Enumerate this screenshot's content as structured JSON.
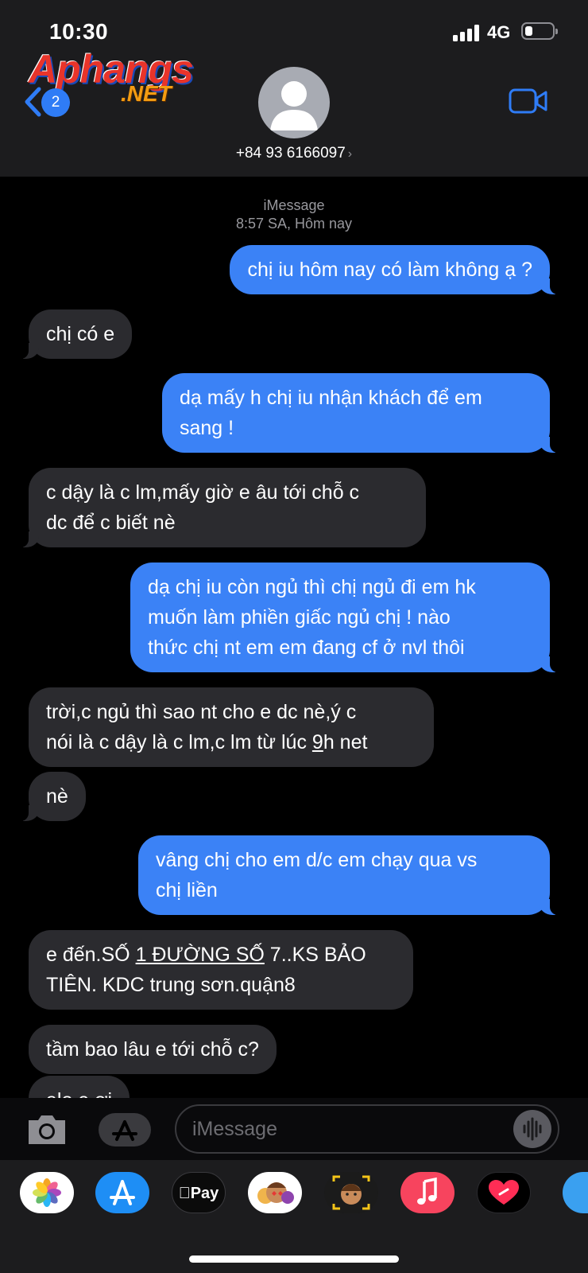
{
  "status": {
    "time": "10:30",
    "network": "4G"
  },
  "watermark": {
    "main": "Aphangs",
    "suffix": ".NET"
  },
  "header": {
    "back_badge": "2",
    "contact": "+84 93 6166097",
    "chevron": "›"
  },
  "thread": {
    "service": "iMessage",
    "timestamp": "8:57 SA, Hôm nay"
  },
  "messages": [
    {
      "side": "out",
      "lines": [
        "chị iu hôm nay có làm không ạ ?"
      ]
    },
    {
      "side": "in",
      "lines": [
        "chị có e"
      ]
    },
    {
      "side": "out",
      "lines": [
        "dạ mấy h chị iu nhận khách để em",
        "sang !"
      ]
    },
    {
      "side": "in",
      "lines": [
        "c dậy là c lm,mấy giờ e âu tới chỗ c",
        "dc để c biết nè"
      ]
    },
    {
      "side": "out",
      "lines": [
        "dạ chị iu còn ngủ thì chị ngủ đi em hk",
        "muốn làm phiền giấc ngủ chị ! nào",
        "thức chị nt em em đang cf ở nvl thôi"
      ]
    },
    {
      "side": "in",
      "lines": [
        "trời,c ngủ thì sao nt cho e dc nè,ý c",
        "nói là c dậy là c lm,c lm từ lúc"
      ],
      "line2_link": "9",
      "line2_rest": "h net"
    },
    {
      "side": "in",
      "lines": [
        "nè"
      ]
    },
    {
      "side": "out",
      "lines": [
        "vâng chị cho em d/c em chạy qua vs",
        "chị liền"
      ]
    },
    {
      "side": "in",
      "line1_a": "e đến.SỐ ",
      "line1_link": "1 ĐƯỜNG SỐ",
      "line1_b": " 7..KS BẢO",
      "lines": [
        "",
        "TIÊN. KDC trung sơn.quận8"
      ]
    },
    {
      "side": "in",
      "lines": [
        "tầm bao lâu e tới chỗ c?"
      ]
    },
    {
      "side": "in",
      "lines": [
        "alo e ơi"
      ]
    }
  ],
  "compose": {
    "placeholder": "iMessage"
  },
  "app_drawer": [
    {
      "name": "photos",
      "color": "#ffffff"
    },
    {
      "name": "app-store",
      "color": "#1e8ef5"
    },
    {
      "name": "apple-pay",
      "label": "Pay",
      "color": "#0b0b0b"
    },
    {
      "name": "memoji-stickers",
      "color": "#ffffff"
    },
    {
      "name": "memoji",
      "color": "#1b1b1b"
    },
    {
      "name": "music",
      "color": "#f7445e"
    },
    {
      "name": "digital-touch",
      "color": "#000000"
    },
    {
      "name": "more-app",
      "color": "#3aa0f0"
    }
  ],
  "colors": {
    "outgoing": "#3b82f6",
    "incoming": "#2b2b2f",
    "accent": "#2f7cf6"
  }
}
